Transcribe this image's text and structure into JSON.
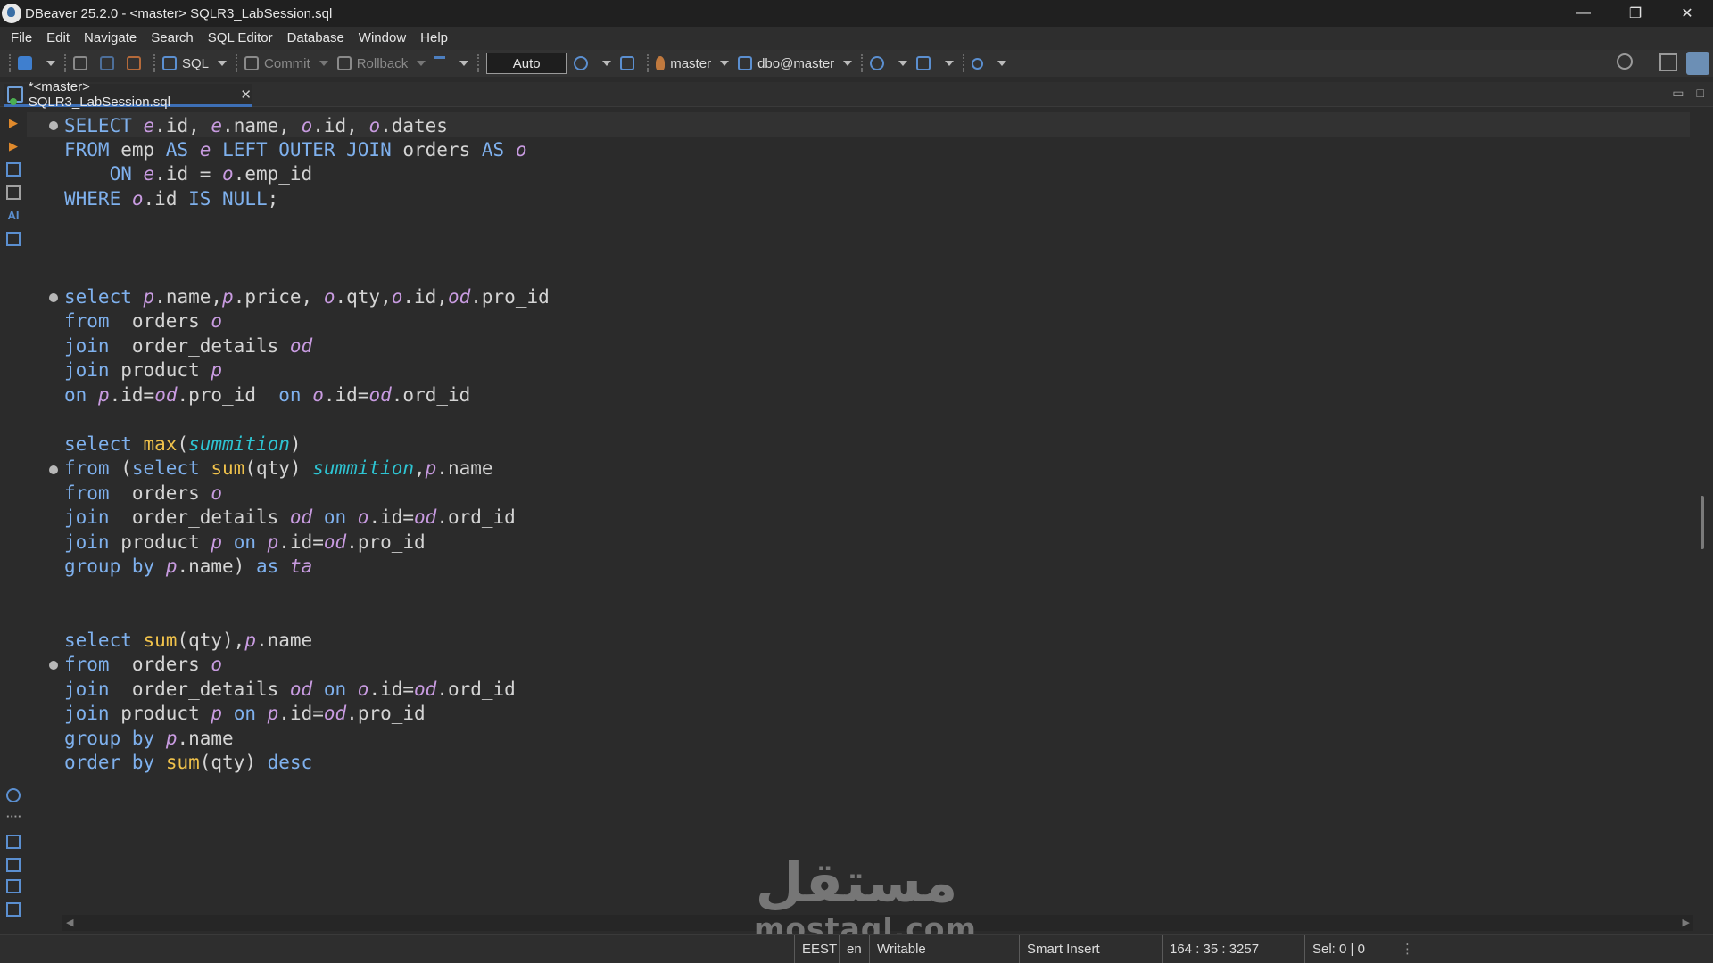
{
  "window": {
    "title": "DBeaver 25.2.0 - <master> SQLR3_LabSession.sql",
    "minimize": "—",
    "restore": "❐",
    "close": "✕"
  },
  "menu": [
    "File",
    "Edit",
    "Navigate",
    "Search",
    "SQL Editor",
    "Database",
    "Window",
    "Help"
  ],
  "toolbar": {
    "sql_label": "SQL",
    "commit_label": "Commit",
    "rollback_label": "Rollback",
    "transaction_mode": "Auto",
    "datasource": "master",
    "schema": "dbo@master"
  },
  "tab": {
    "label": "*<master> SQLR3_LabSession.sql",
    "close": "✕"
  },
  "ruler": {
    "ai_label": "AI"
  },
  "editor": {
    "lines": [
      "SELECT e.id, e.name, o.id, o.dates",
      "FROM emp AS e LEFT OUTER JOIN orders AS o",
      "    ON e.id = o.emp_id",
      "WHERE o.id IS NULL;",
      "select p.name,p.price, o.qty,o.id,od.pro_id",
      "from  orders o",
      "join  order_details od",
      "join product p",
      "on p.id=od.pro_id  on o.id=od.ord_id",
      "select max(summition)",
      "from (select sum(qty) summition,p.name",
      "from  orders o",
      "join  order_details od on o.id=od.ord_id",
      "join product p on p.id=od.pro_id",
      "group by p.name) as ta",
      "select sum(qty),p.name",
      "from  orders o",
      "join  order_details od on o.id=od.ord_id",
      "join product p on p.id=od.pro_id",
      "group by p.name",
      "order by sum(qty) desc"
    ]
  },
  "watermark": {
    "arabic": "مستقل",
    "latin": "mostaql.com"
  },
  "status": {
    "timezone": "EEST",
    "locale": "en",
    "mode": "Writable",
    "insert_mode": "Smart Insert",
    "position": "164 : 35 : 3257",
    "selection": "Sel: 0 | 0"
  },
  "colors": {
    "keyword": "#7fb1ee",
    "function": "#f0c24b",
    "alias": "#c89be0",
    "column_alias": "#2ec4d2",
    "background": "#2b2b2b"
  }
}
